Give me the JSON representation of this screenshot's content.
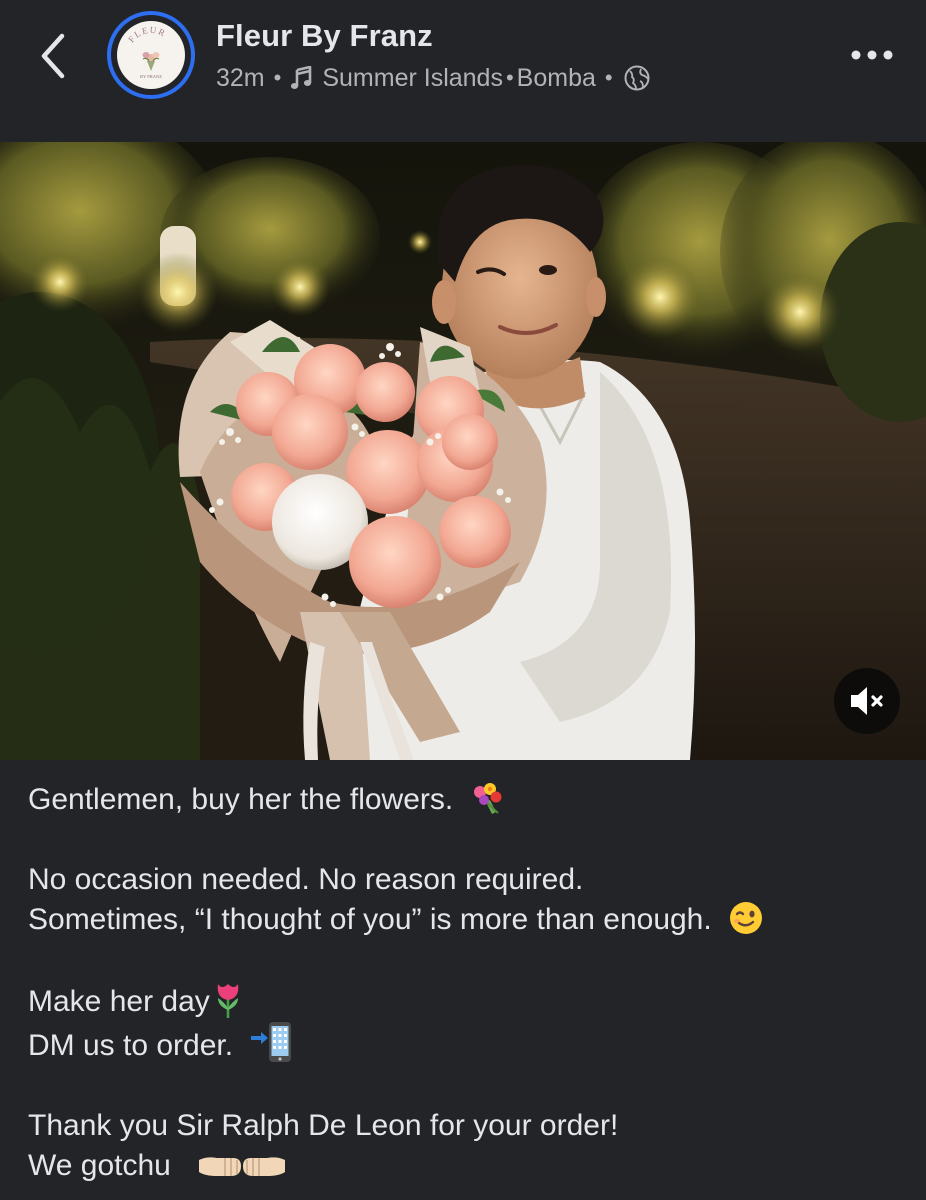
{
  "header": {
    "page_name": "Fleur By Franz",
    "time": "32m",
    "song_title": "Summer Islands",
    "artist": "Bomba",
    "avatar_logo_text": "FLEUR",
    "avatar_logo_subtext": "BY FRANZ",
    "back_icon": "chevron-left-icon",
    "more_icon": "more-horizontal-icon",
    "music_icon": "music-note-icon",
    "audience_icon": "globe-icon"
  },
  "media": {
    "sound_state": "muted",
    "sound_icon": "speaker-muted-icon"
  },
  "caption": {
    "line1": "Gentlemen, buy her the flowers.",
    "line2": "No occasion needed. No reason required.",
    "line3": "Sometimes, “I thought of you” is more than enough.",
    "line4": "Make her day",
    "line5": "DM us to order.",
    "line6": "Thank you Sir Ralph De Leon for your order!",
    "line7": "We gotchu",
    "emoji_1": "bouquet",
    "emoji_2": "winking-face",
    "emoji_3": "tulip",
    "emoji_4": "mobile-phone-with-arrow",
    "emoji_5": "fist-bump"
  },
  "colors": {
    "background": "#232427",
    "primary_text": "#e4e6eb",
    "secondary_text": "#b0b3b8",
    "story_ring": "#2d6ff0"
  }
}
